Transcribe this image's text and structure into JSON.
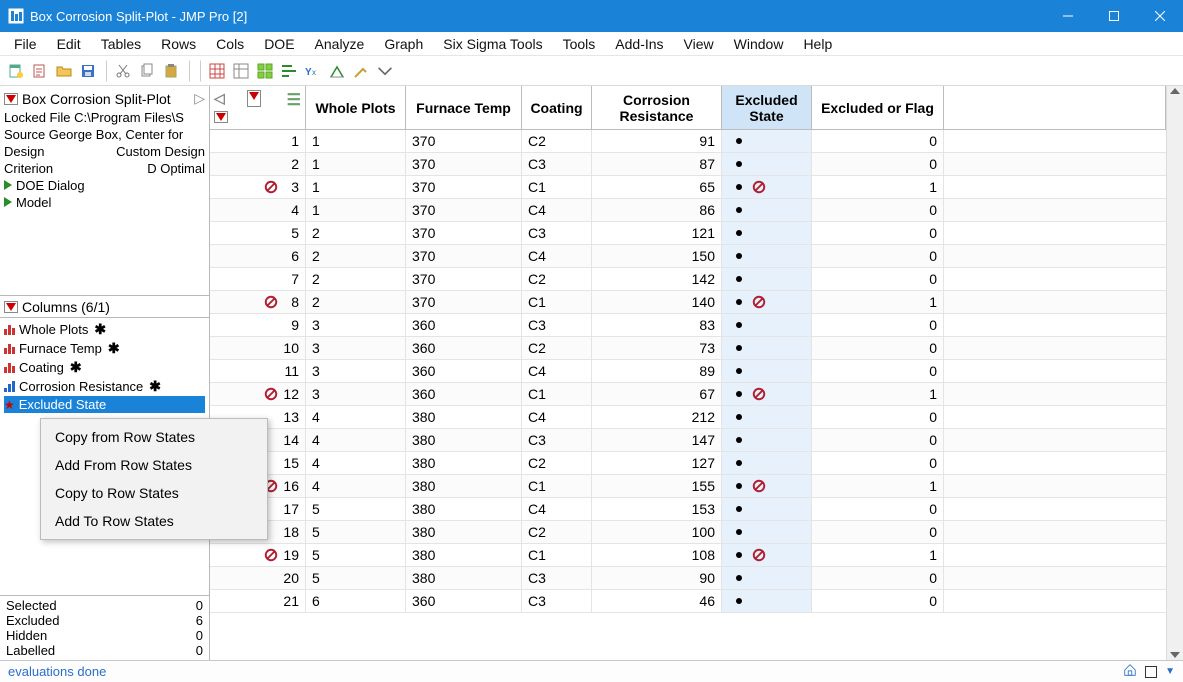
{
  "window": {
    "title": "Box Corrosion Split-Plot - JMP Pro [2]"
  },
  "menu": [
    "File",
    "Edit",
    "Tables",
    "Rows",
    "Cols",
    "DOE",
    "Analyze",
    "Graph",
    "Six Sigma Tools",
    "Tools",
    "Add-Ins",
    "View",
    "Window",
    "Help"
  ],
  "left_top": {
    "title": "Box Corrosion Split-Plot",
    "locked_file": "Locked File  C:\\Program Files\\S",
    "source": "Source  George Box, Center for",
    "design_label": "Design",
    "design_value": "Custom Design",
    "criterion_label": "Criterion",
    "criterion_value": "D Optimal",
    "doe_dialog": "DOE Dialog",
    "model": "Model"
  },
  "columns_header": "Columns (6/1)",
  "columns": [
    {
      "name": "Whole Plots",
      "kind": "nominal",
      "ast": true
    },
    {
      "name": "Furnace Temp",
      "kind": "nominal",
      "ast": true
    },
    {
      "name": "Coating",
      "kind": "nominal",
      "ast": true
    },
    {
      "name": "Corrosion Resistance",
      "kind": "continuous",
      "ast": true
    },
    {
      "name": "Excluded State",
      "kind": "rowstate",
      "ast": false,
      "selected": true
    }
  ],
  "context_menu": [
    "Copy from Row States",
    "Add From Row States",
    "Copy to Row States",
    "Add To Row States"
  ],
  "rowstates": {
    "Selected": "0",
    "Excluded": "6",
    "Hidden": "0",
    "Labelled": "0"
  },
  "grid_headers": {
    "whole_plots": "Whole Plots",
    "furnace_temp": "Furnace Temp",
    "coating": "Coating",
    "corrosion": "Corrosion\nResistance",
    "excluded_state": "Excluded\nState",
    "excluded_flag": "Excluded or Flag"
  },
  "rows": [
    {
      "n": 1,
      "wp": "1",
      "ft": "370",
      "ct": "C2",
      "cr": "91",
      "ex": false,
      "ef": "0"
    },
    {
      "n": 2,
      "wp": "1",
      "ft": "370",
      "ct": "C3",
      "cr": "87",
      "ex": false,
      "ef": "0"
    },
    {
      "n": 3,
      "wp": "1",
      "ft": "370",
      "ct": "C1",
      "cr": "65",
      "ex": true,
      "ef": "1"
    },
    {
      "n": 4,
      "wp": "1",
      "ft": "370",
      "ct": "C4",
      "cr": "86",
      "ex": false,
      "ef": "0"
    },
    {
      "n": 5,
      "wp": "2",
      "ft": "370",
      "ct": "C3",
      "cr": "121",
      "ex": false,
      "ef": "0"
    },
    {
      "n": 6,
      "wp": "2",
      "ft": "370",
      "ct": "C4",
      "cr": "150",
      "ex": false,
      "ef": "0"
    },
    {
      "n": 7,
      "wp": "2",
      "ft": "370",
      "ct": "C2",
      "cr": "142",
      "ex": false,
      "ef": "0"
    },
    {
      "n": 8,
      "wp": "2",
      "ft": "370",
      "ct": "C1",
      "cr": "140",
      "ex": true,
      "ef": "1"
    },
    {
      "n": 9,
      "wp": "3",
      "ft": "360",
      "ct": "C3",
      "cr": "83",
      "ex": false,
      "ef": "0"
    },
    {
      "n": 10,
      "wp": "3",
      "ft": "360",
      "ct": "C2",
      "cr": "73",
      "ex": false,
      "ef": "0"
    },
    {
      "n": 11,
      "wp": "3",
      "ft": "360",
      "ct": "C4",
      "cr": "89",
      "ex": false,
      "ef": "0"
    },
    {
      "n": 12,
      "wp": "3",
      "ft": "360",
      "ct": "C1",
      "cr": "67",
      "ex": true,
      "ef": "1"
    },
    {
      "n": 13,
      "wp": "4",
      "ft": "380",
      "ct": "C4",
      "cr": "212",
      "ex": false,
      "ef": "0"
    },
    {
      "n": 14,
      "wp": "4",
      "ft": "380",
      "ct": "C3",
      "cr": "147",
      "ex": false,
      "ef": "0"
    },
    {
      "n": 15,
      "wp": "4",
      "ft": "380",
      "ct": "C2",
      "cr": "127",
      "ex": false,
      "ef": "0"
    },
    {
      "n": 16,
      "wp": "4",
      "ft": "380",
      "ct": "C1",
      "cr": "155",
      "ex": true,
      "ef": "1"
    },
    {
      "n": 17,
      "wp": "5",
      "ft": "380",
      "ct": "C4",
      "cr": "153",
      "ex": false,
      "ef": "0"
    },
    {
      "n": 18,
      "wp": "5",
      "ft": "380",
      "ct": "C2",
      "cr": "100",
      "ex": false,
      "ef": "0"
    },
    {
      "n": 19,
      "wp": "5",
      "ft": "380",
      "ct": "C1",
      "cr": "108",
      "ex": true,
      "ef": "1"
    },
    {
      "n": 20,
      "wp": "5",
      "ft": "380",
      "ct": "C3",
      "cr": "90",
      "ex": false,
      "ef": "0"
    },
    {
      "n": 21,
      "wp": "6",
      "ft": "360",
      "ct": "C3",
      "cr": "46",
      "ex": false,
      "ef": "0"
    }
  ],
  "status": "evaluations done"
}
